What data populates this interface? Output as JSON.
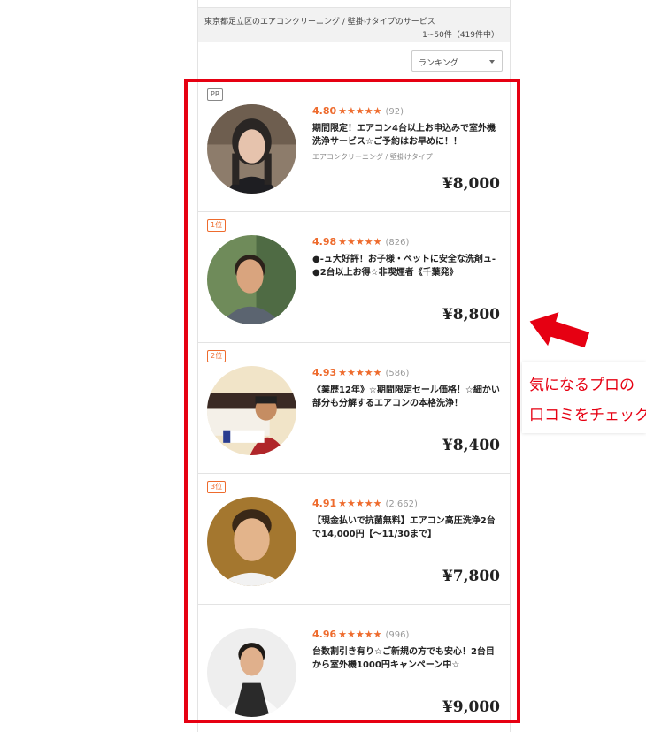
{
  "header": {
    "breadcrumb": "東京都足立区のエアコンクリーニング / 壁掛けタイプのサービス",
    "result_count": "1~50件（419件中）",
    "sort_label": "ランキング"
  },
  "listings": [
    {
      "badge": "PR",
      "score": "4.80",
      "stars": "★★★★★",
      "reviews": "(92)",
      "title": "期間限定！エアコン4台以上お申込みで室外機洗浄サービス☆ご予約はお早めに！！",
      "category": "エアコンクリーニング / 壁掛けタイプ",
      "price": "¥8,000"
    },
    {
      "badge": "1位",
      "score": "4.98",
      "stars": "★★★★★",
      "reviews": "(826)",
      "title": "●-ュ大好評！お子様・ペットに安全な洗剤ュ-●2台以上お得☆非喫煙者《千葉発》",
      "category": "",
      "price": "¥8,800"
    },
    {
      "badge": "2位",
      "score": "4.93",
      "stars": "★★★★★",
      "reviews": "(586)",
      "title": "《業歴12年》☆期間限定セール価格！☆細かい部分も分解するエアコンの本格洗浄！",
      "category": "",
      "price": "¥8,400"
    },
    {
      "badge": "3位",
      "score": "4.91",
      "stars": "★★★★★",
      "reviews": "(2,662)",
      "title": "【現金払いで抗菌無料】エアコン高圧洗浄2台で14,000円【～11/30まで】",
      "category": "",
      "price": "¥7,800"
    },
    {
      "badge": "",
      "score": "4.96",
      "stars": "★★★★★",
      "reviews": "(996)",
      "title": "台数割引き有り☆ご新規の方でも安心！2台目から室外機1000円キャンペーン中☆",
      "category": "",
      "price": "¥9,000"
    }
  ],
  "annotation": {
    "line1": "気になるプロの",
    "line2": "口コミをチェック",
    "color": "#e60012"
  }
}
